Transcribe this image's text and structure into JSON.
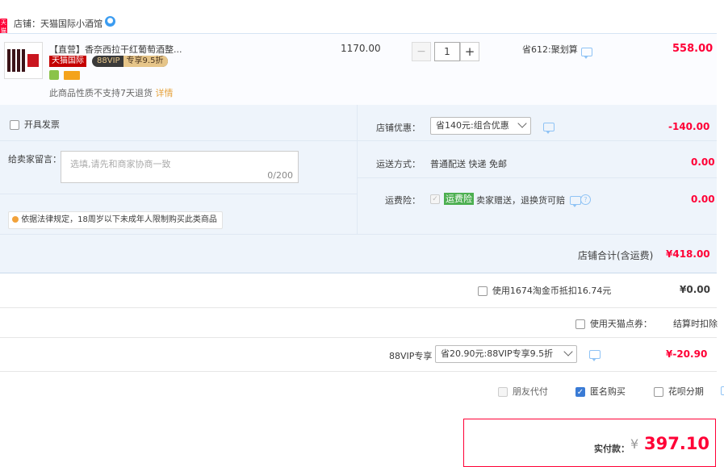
{
  "shop": {
    "badge": "天猫",
    "label": "店铺：天猫国际小酒馆"
  },
  "item": {
    "title": "【直营】香奈西拉干红葡萄酒整...",
    "brand_tag": "天猫国际",
    "vip_tag_left": "88VIP",
    "vip_tag_right": "专享9.5折",
    "notice": "此商品性质不支持7天退货",
    "notice_link": "详情",
    "unit_price": "1170.00",
    "quantity": "1",
    "minus": "−",
    "plus": "+",
    "discount": "省612:聚划算",
    "total": "558.00"
  },
  "invoice": {
    "label": "开具发票"
  },
  "message": {
    "label": "给卖家留言：",
    "placeholder": "选填,请先和商家协商一致",
    "counter": "0/200"
  },
  "legal": {
    "text": "依据法律规定，18周岁以下未成年人限制购买此类商品"
  },
  "shop_coupon": {
    "label": "店铺优惠：",
    "selected": "省140元:组合优惠",
    "amount": "-140.00"
  },
  "shipping": {
    "label": "运送方式：",
    "method": "普通配送 快递 免邮",
    "amount": "0.00"
  },
  "insurance": {
    "label": "运费险：",
    "tag": "运费险",
    "text": "卖家赠送，退换货可赔",
    "amount": "0.00"
  },
  "shop_total": {
    "label": "店铺合计(含运费)",
    "amount": "¥418.00"
  },
  "taojinbi": {
    "label": "使用1674淘金币抵扣16.74元",
    "amount": "¥0.00"
  },
  "tmall_points": {
    "label": "使用天猫点券：",
    "value": "结算时扣除"
  },
  "vip88": {
    "label": "88VIP专享",
    "selected": "省20.90元:88VIP专享9.5折",
    "amount": "¥-20.90"
  },
  "options": {
    "friend_pay": "朋友代付",
    "anonymous": "匿名购买",
    "huabei": "花呗分期"
  },
  "pay": {
    "label": "实付款：",
    "currency": "¥",
    "amount": "397.10"
  }
}
